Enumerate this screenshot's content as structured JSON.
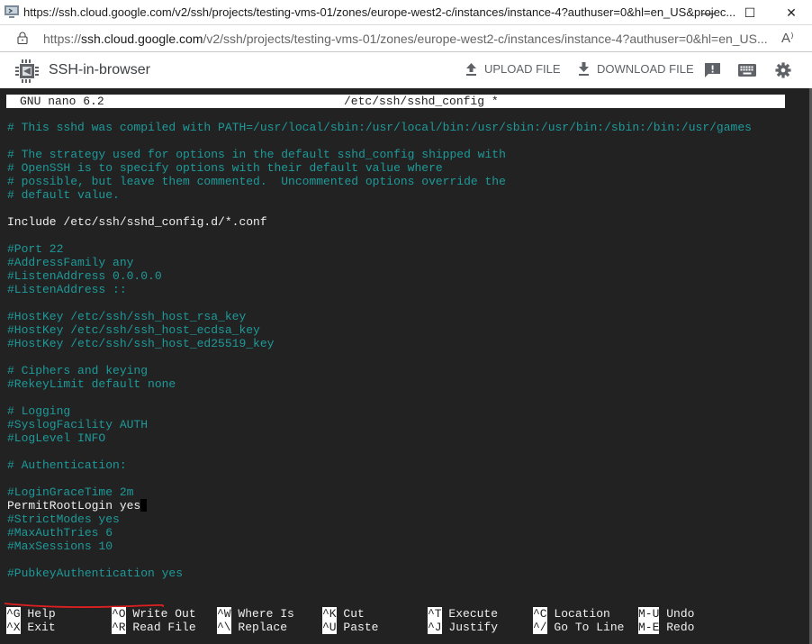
{
  "window": {
    "title": "https://ssh.cloud.google.com/v2/ssh/projects/testing-vms-01/zones/europe-west2-c/instances/instance-4?authuser=0&hl=en_US&projec...",
    "controls": {
      "minimize": "—",
      "maximize": "☐",
      "close": "✕"
    }
  },
  "addressbar": {
    "scheme": "https://",
    "host": "ssh.cloud.google.com",
    "path": "/v2/ssh/projects/testing-vms-01/zones/europe-west2-c/instances/instance-4?authuser=0&hl=en_US...",
    "read_aloud_icon": "A⁾"
  },
  "toolbar": {
    "app_title": "SSH-in-browser",
    "upload_label": "UPLOAD FILE",
    "download_label": "DOWNLOAD FILE",
    "icons": [
      "feedback-icon",
      "keyboard-icon",
      "gear-icon"
    ]
  },
  "nano": {
    "version": "GNU nano 6.2",
    "filename": "/etc/ssh/sshd_config *",
    "lines": [
      {
        "text": "# This sshd was compiled with PATH=/usr/local/sbin:/usr/local/bin:/usr/sbin:/usr/bin:/sbin:/bin:/usr/games",
        "type": "comment"
      },
      {
        "text": "",
        "type": "blank"
      },
      {
        "text": "# The strategy used for options in the default sshd_config shipped with",
        "type": "comment"
      },
      {
        "text": "# OpenSSH is to specify options with their default value where",
        "type": "comment"
      },
      {
        "text": "# possible, but leave them commented.  Uncommented options override the",
        "type": "comment"
      },
      {
        "text": "# default value.",
        "type": "comment"
      },
      {
        "text": "",
        "type": "blank"
      },
      {
        "text": "Include /etc/ssh/sshd_config.d/*.conf",
        "type": "plain"
      },
      {
        "text": "",
        "type": "blank"
      },
      {
        "text": "#Port 22",
        "type": "comment"
      },
      {
        "text": "#AddressFamily any",
        "type": "comment"
      },
      {
        "text": "#ListenAddress 0.0.0.0",
        "type": "comment"
      },
      {
        "text": "#ListenAddress ::",
        "type": "comment"
      },
      {
        "text": "",
        "type": "blank"
      },
      {
        "text": "#HostKey /etc/ssh/ssh_host_rsa_key",
        "type": "comment"
      },
      {
        "text": "#HostKey /etc/ssh/ssh_host_ecdsa_key",
        "type": "comment"
      },
      {
        "text": "#HostKey /etc/ssh/ssh_host_ed25519_key",
        "type": "comment"
      },
      {
        "text": "",
        "type": "blank"
      },
      {
        "text": "# Ciphers and keying",
        "type": "comment"
      },
      {
        "text": "#RekeyLimit default none",
        "type": "comment"
      },
      {
        "text": "",
        "type": "blank"
      },
      {
        "text": "# Logging",
        "type": "comment"
      },
      {
        "text": "#SyslogFacility AUTH",
        "type": "comment"
      },
      {
        "text": "#LogLevel INFO",
        "type": "comment"
      },
      {
        "text": "",
        "type": "blank"
      },
      {
        "text": "# Authentication:",
        "type": "comment"
      },
      {
        "text": "",
        "type": "blank"
      },
      {
        "text": "#LoginGraceTime 2m",
        "type": "comment"
      },
      {
        "text": "PermitRootLogin yes",
        "type": "plain",
        "cursor": true
      },
      {
        "text": "#StrictModes yes",
        "type": "comment"
      },
      {
        "text": "#MaxAuthTries 6",
        "type": "comment"
      },
      {
        "text": "#MaxSessions 10",
        "type": "comment"
      },
      {
        "text": "",
        "type": "blank"
      },
      {
        "text": "#PubkeyAuthentication yes",
        "type": "comment"
      }
    ],
    "shortcuts": [
      [
        {
          "key": "^G",
          "label": "Help"
        },
        {
          "key": "^O",
          "label": "Write Out"
        },
        {
          "key": "^W",
          "label": "Where Is"
        },
        {
          "key": "^K",
          "label": "Cut"
        },
        {
          "key": "^T",
          "label": "Execute"
        },
        {
          "key": "^C",
          "label": "Location"
        },
        {
          "key": "M-U",
          "label": "Undo"
        }
      ],
      [
        {
          "key": "^X",
          "label": "Exit"
        },
        {
          "key": "^R",
          "label": "Read File"
        },
        {
          "key": "^\\",
          "label": "Replace"
        },
        {
          "key": "^U",
          "label": "Paste"
        },
        {
          "key": "^J",
          "label": "Justify"
        },
        {
          "key": "^/",
          "label": "Go To Line"
        },
        {
          "key": "M-E",
          "label": "Redo"
        }
      ]
    ]
  },
  "colors": {
    "terminal_bg": "#222222",
    "comment": "#1e9a9a",
    "annotation": "#e02020"
  }
}
